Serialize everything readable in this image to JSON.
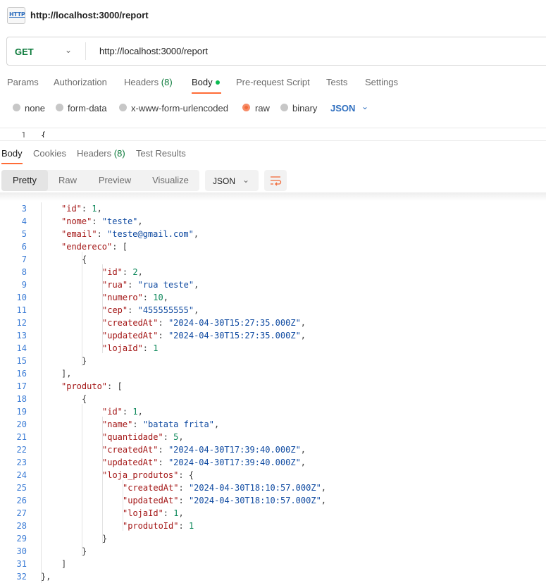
{
  "top": {
    "title": "http://localhost:3000/report",
    "icon": "http-file-icon"
  },
  "request": {
    "method": "GET",
    "url": "http://localhost:3000/report",
    "tabs": [
      {
        "label": "Params"
      },
      {
        "label": "Authorization"
      },
      {
        "label": "Headers",
        "count": "(8)"
      },
      {
        "label": "Body",
        "active": true,
        "dot": true
      },
      {
        "label": "Pre-request Script"
      },
      {
        "label": "Tests"
      },
      {
        "label": "Settings"
      }
    ],
    "body_modes": [
      "none",
      "form-data",
      "x-www-form-urlencoded",
      "raw",
      "binary"
    ],
    "body_mode_selected": "raw",
    "raw_type": "JSON",
    "editor_first_line_number": "1",
    "editor_first_line_code": "{"
  },
  "response": {
    "tabs": [
      {
        "label": "Body",
        "active": true
      },
      {
        "label": "Cookies"
      },
      {
        "label": "Headers",
        "count": "(8)"
      },
      {
        "label": "Test Results"
      }
    ],
    "format_buttons": [
      "Pretty",
      "Raw",
      "Preview",
      "Visualize"
    ],
    "format_selected": "Pretty",
    "language": "JSON",
    "lines": [
      {
        "n": "3",
        "text": "\"id\": 1,"
      },
      {
        "n": "4",
        "text": "\"nome\": \"teste\","
      },
      {
        "n": "5",
        "text": "\"email\": \"teste@gmail.com\","
      },
      {
        "n": "6",
        "text": "\"endereco\": ["
      },
      {
        "n": "7",
        "text": "{"
      },
      {
        "n": "8",
        "text": "\"id\": 2,"
      },
      {
        "n": "9",
        "text": "\"rua\": \"rua teste\","
      },
      {
        "n": "10",
        "text": "\"numero\": 10,"
      },
      {
        "n": "11",
        "text": "\"cep\": \"455555555\","
      },
      {
        "n": "12",
        "text": "\"createdAt\": \"2024-04-30T15:27:35.000Z\","
      },
      {
        "n": "13",
        "text": "\"updatedAt\": \"2024-04-30T15:27:35.000Z\","
      },
      {
        "n": "14",
        "text": "\"lojaId\": 1"
      },
      {
        "n": "15",
        "text": "}"
      },
      {
        "n": "16",
        "text": "],"
      },
      {
        "n": "17",
        "text": "\"produto\": ["
      },
      {
        "n": "18",
        "text": "{"
      },
      {
        "n": "19",
        "text": "\"id\": 1,"
      },
      {
        "n": "20",
        "text": "\"name\": \"batata frita\","
      },
      {
        "n": "21",
        "text": "\"quantidade\": 5,"
      },
      {
        "n": "22",
        "text": "\"createdAt\": \"2024-04-30T17:39:40.000Z\","
      },
      {
        "n": "23",
        "text": "\"updatedAt\": \"2024-04-30T17:39:40.000Z\","
      },
      {
        "n": "24",
        "text": "\"loja_produtos\": {"
      },
      {
        "n": "25",
        "text": "\"createdAt\": \"2024-04-30T18:10:57.000Z\","
      },
      {
        "n": "26",
        "text": "\"updatedAt\": \"2024-04-30T18:10:57.000Z\","
      },
      {
        "n": "27",
        "text": "\"lojaId\": 1,"
      },
      {
        "n": "28",
        "text": "\"produtoId\": 1"
      },
      {
        "n": "29",
        "text": "}"
      },
      {
        "n": "30",
        "text": "}"
      },
      {
        "n": "31",
        "text": "]"
      },
      {
        "n": "32",
        "text": "},"
      }
    ]
  },
  "colors": {
    "accent": "#ff6c37",
    "method": "#0c7a3b",
    "link": "#2f6fbf",
    "key": "#a31515",
    "string": "#0f4aa1",
    "number": "#098658"
  }
}
